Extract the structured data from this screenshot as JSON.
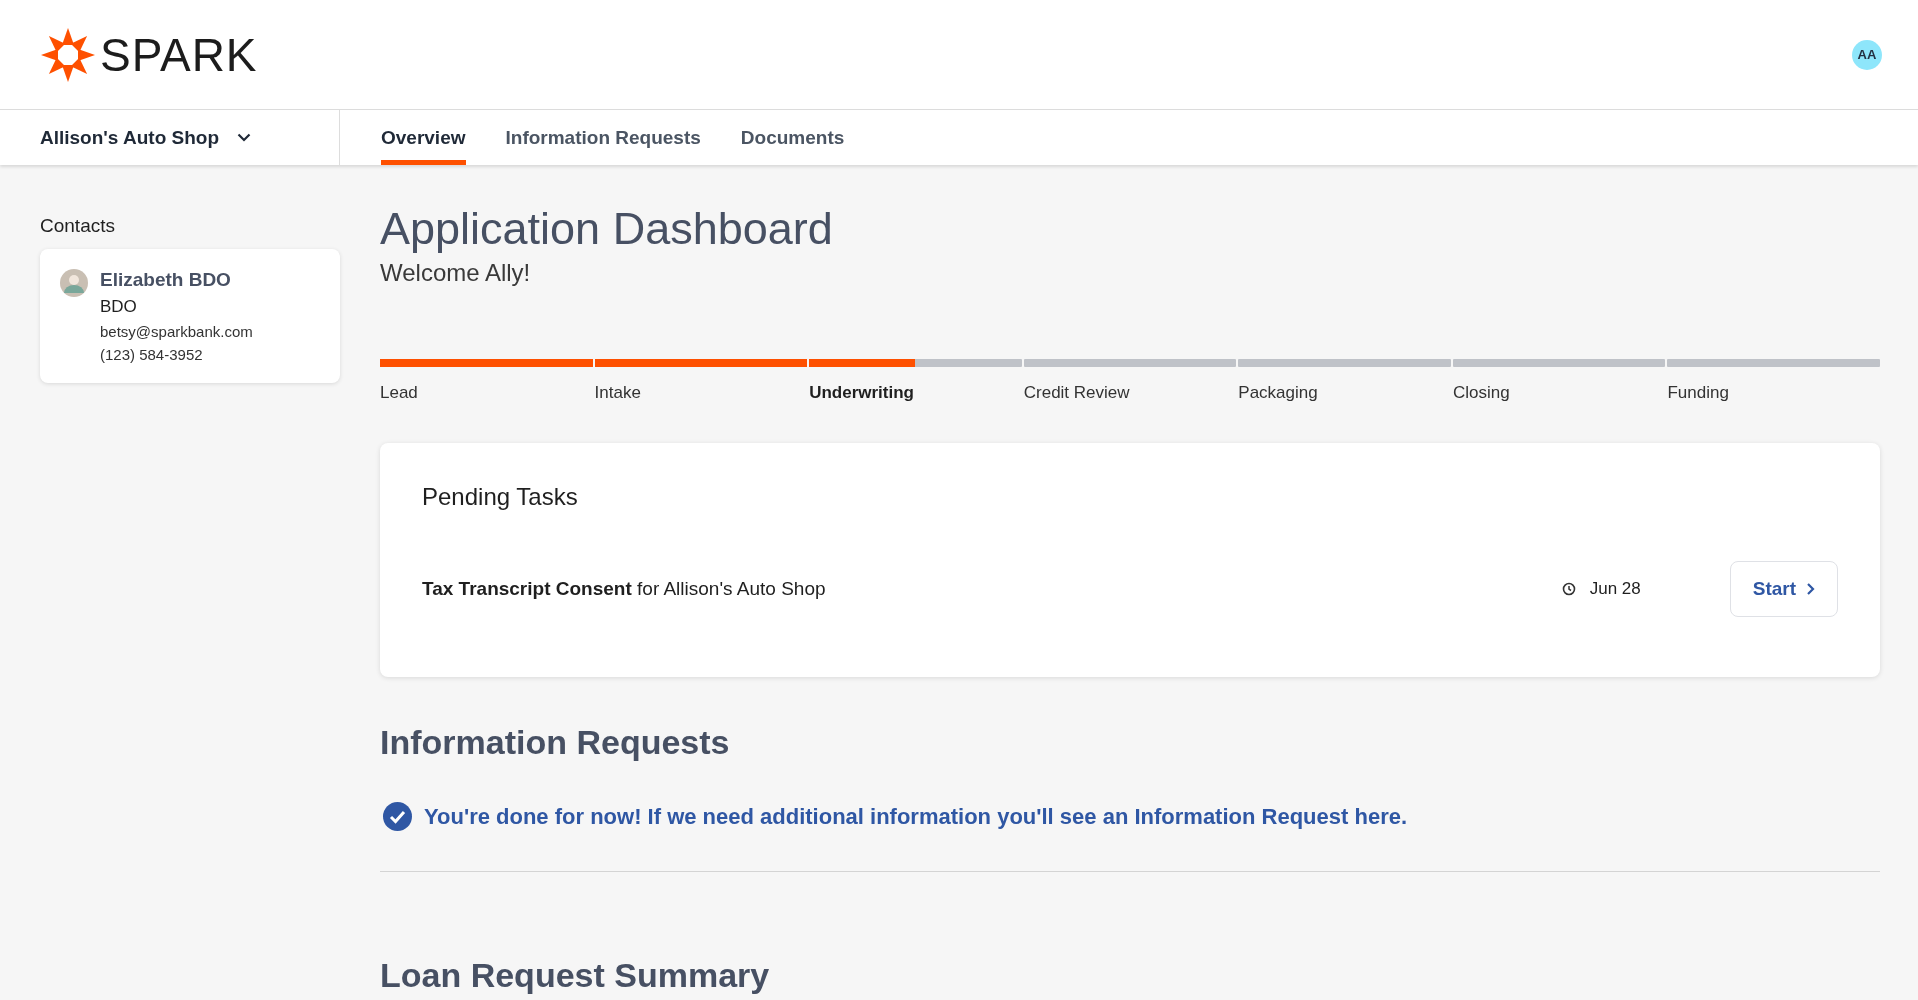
{
  "header": {
    "logo": "SPARK",
    "avatar": "AA"
  },
  "nav": {
    "business": "Allison's Auto Shop",
    "tabs": [
      {
        "label": "Overview",
        "selected": true
      },
      {
        "label": "Information Requests",
        "selected": false
      },
      {
        "label": "Documents",
        "selected": false
      }
    ]
  },
  "sidebar": {
    "title": "Contacts",
    "contacts": [
      {
        "name": "Elizabeth BDO",
        "role": "BDO",
        "email": "betsy@sparkbank.com",
        "phone": "(123) 584-3952"
      }
    ]
  },
  "dashboard": {
    "title": "Application Dashboard",
    "subtitle": "Welcome Ally!"
  },
  "stages": [
    {
      "label": "Lead",
      "level": 1,
      "selected": false
    },
    {
      "label": "Intake",
      "level": 1,
      "selected": false
    },
    {
      "label": "Underwriting",
      "level": 0.5,
      "selected": true
    },
    {
      "label": "Credit Review",
      "level": 0,
      "selected": false
    },
    {
      "label": "Packaging",
      "level": 0,
      "selected": false
    },
    {
      "label": "Closing",
      "level": 0,
      "selected": false
    },
    {
      "label": "Funding",
      "level": 0,
      "selected": false
    }
  ],
  "pending_tasks": {
    "title": "Pending Tasks",
    "tasks": [
      {
        "text": "**Tax Transcript Consent** for Allison's Auto Shop",
        "due": "Jun 28",
        "action": "Start"
      }
    ]
  },
  "information_requests": {
    "title": "Information Requests",
    "message": "You're done for now! If we need additional information you'll see an Information Request here."
  },
  "loan_summary": {
    "title": "Loan Request Summary"
  }
}
